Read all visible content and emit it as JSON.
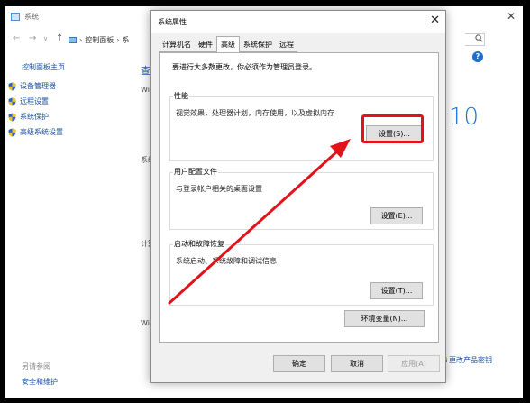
{
  "background_window": {
    "title": "系统",
    "address": {
      "path": [
        "控制面板",
        "系"
      ]
    },
    "sidebar": {
      "home_link": "控制面板主页",
      "items": [
        {
          "label": "设备管理器",
          "top": 0
        },
        {
          "label": "远程设置"
        },
        {
          "label": "系统保护"
        },
        {
          "label": "高级系统设置"
        }
      ],
      "see_also": "另请参阅",
      "security_link": "安全和维护"
    },
    "main": {
      "heading_peek": "查",
      "peek_1": "Win",
      "peek_2": "系统",
      "peek_3": "计算",
      "peek_4": "Win",
      "win10": "10",
      "right_link": "更改产品密钥"
    }
  },
  "dialog": {
    "title": "系统属性",
    "tabs": [
      "计算机名",
      "硬件",
      "高级",
      "系统保护",
      "远程"
    ],
    "active_tab": "高级",
    "admin_note": "要进行大多数更改，你必须作为管理员登录。",
    "performance": {
      "title": "性能",
      "desc": "视觉效果，处理器计划，内存使用，以及虚拟内存",
      "button": "设置(S)..."
    },
    "user_profiles": {
      "title": "用户配置文件",
      "desc": "与登录帐户相关的桌面设置",
      "button": "设置(E)..."
    },
    "startup_recovery": {
      "title": "启动和故障恢复",
      "desc": "系统启动、系统故障和调试信息",
      "button": "设置(T)..."
    },
    "env_button": "环境变量(N)...",
    "ok_button": "确定",
    "cancel_button": "取消",
    "apply_button": "应用(A)"
  },
  "colors": {
    "annotation": "#e1121a",
    "link": "#1a4fa0",
    "accent": "#1a73d9"
  }
}
